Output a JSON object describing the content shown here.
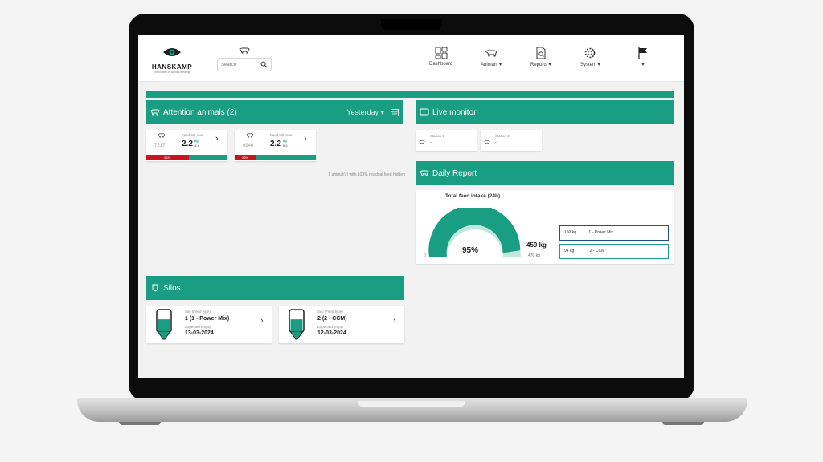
{
  "header": {
    "brand": "HANSKAMP",
    "tagline": "Innovation in animal feeding",
    "search_placeholder": "Search",
    "nav": [
      {
        "label": "Dashboard",
        "icon": "dashboard-icon"
      },
      {
        "label": "Animals ▾",
        "icon": "cow-icon"
      },
      {
        "label": "Reports ▾",
        "icon": "report-icon"
      },
      {
        "label": "System ▾",
        "icon": "gear-icon"
      },
      {
        "label": "▾",
        "icon": "flag-icon"
      }
    ]
  },
  "attention": {
    "title": "Attention animals (2)",
    "period": "Yesterday ▾",
    "animals": [
      {
        "id": "7217",
        "label": "Feed left over",
        "value": "2.2",
        "unit": "kg",
        "target": "4.4",
        "percent": "52%"
      },
      {
        "id": "6946",
        "label": "Feed left over",
        "value": "2.2",
        "unit": "kg",
        "target": "8.5",
        "percent": "26%"
      }
    ],
    "note": "1 animal(s) with 100% residual feed hidden"
  },
  "live_monitor": {
    "title": "Live monitor",
    "stations": [
      {
        "name": "Station 1",
        "value": "--"
      },
      {
        "name": "Station 2",
        "value": "--"
      }
    ]
  },
  "daily_report": {
    "title": "Daily Report",
    "chart_title": "Total feed intake (24h)",
    "percent": "95%",
    "intake": "459 kg",
    "target": "470 kg",
    "zero": "0",
    "fraction": 0.95,
    "legend": [
      {
        "amount": "160 kg",
        "name": "1 - Power Mix",
        "color": "#1d4f8c"
      },
      {
        "amount": "94 kg",
        "name": "2 - CCM",
        "color": "#199e84"
      }
    ]
  },
  "silos": {
    "title": "Silos",
    "items": [
      {
        "type_label": "Silo (Feed type)",
        "name": "1 (1 - Power Mix)",
        "empty_label": "Expected empty",
        "date": "13-03-2024",
        "level": 0.55
      },
      {
        "type_label": "Silo (Feed type)",
        "name": "2 (2 - CCM)",
        "empty_label": "Expected empty",
        "date": "12-03-2024",
        "level": 0.55
      }
    ]
  },
  "colors": {
    "accent": "#199e84",
    "alert": "#c9141e"
  }
}
